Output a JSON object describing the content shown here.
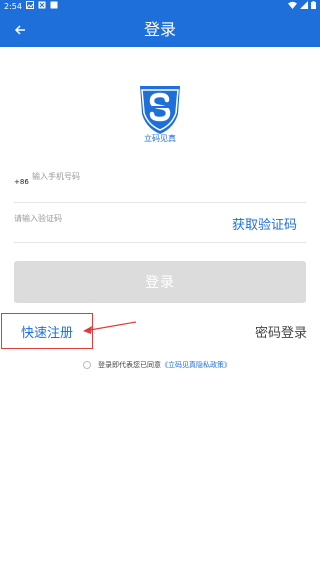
{
  "status_bar": {
    "time": "2:54"
  },
  "app_bar": {
    "title": "登录"
  },
  "logo": {
    "caption": "立码见真"
  },
  "phone": {
    "prefix": "+86",
    "placeholder": "输入手机号码",
    "value": ""
  },
  "code": {
    "placeholder": "请输入验证码",
    "value": "",
    "get_code_label": "获取验证码"
  },
  "login_button": {
    "label": "登录"
  },
  "links": {
    "quick_register": "快速注册",
    "password_login": "密码登录"
  },
  "agreement": {
    "text": "登录即代表您已同意",
    "policy": "《立码见真隐私政策》"
  },
  "colors": {
    "primary": "#1E6FD9",
    "annotation": "#E23B3B",
    "disabled_button": "#DCDCDC"
  }
}
